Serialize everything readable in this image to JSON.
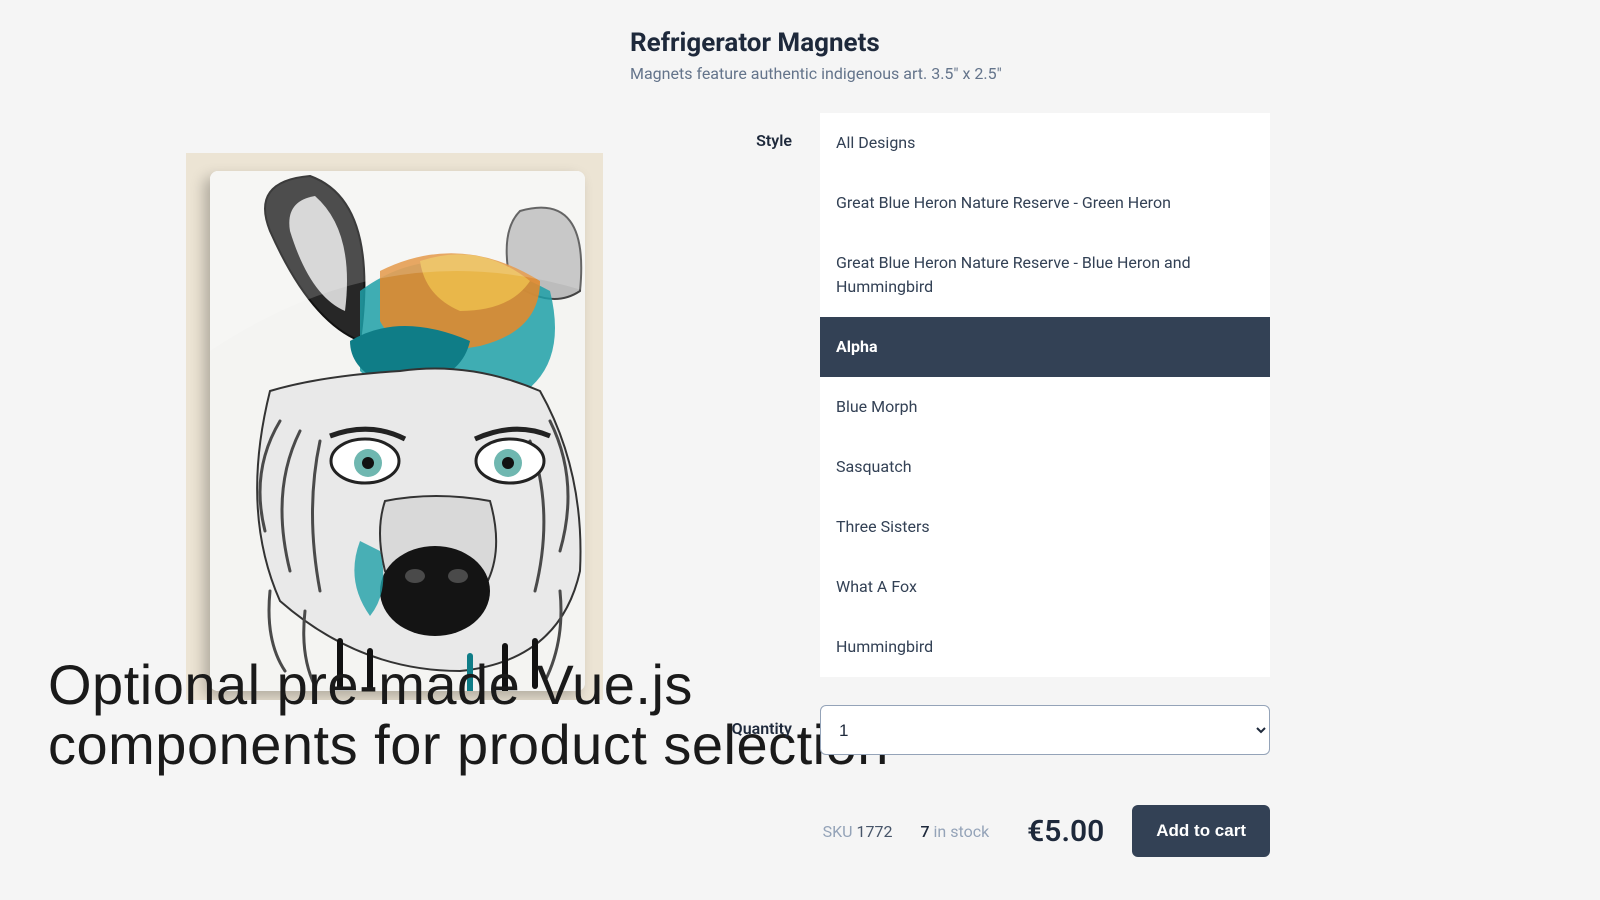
{
  "product": {
    "title": "Refrigerator Magnets",
    "subtitle": "Magnets feature authentic indigenous art. 3.5\" x 2.5\""
  },
  "style": {
    "label": "Style",
    "selected_index": 3,
    "options": [
      "All Designs",
      "Great Blue Heron Nature Reserve - Green Heron",
      "Great Blue Heron Nature Reserve - Blue Heron and Hummingbird",
      "Alpha",
      "Blue Morph",
      "Sasquatch",
      "Three Sisters",
      "What A Fox",
      "Hummingbird"
    ]
  },
  "quantity": {
    "label": "Quantity",
    "value": "1"
  },
  "meta": {
    "sku_label": "SKU",
    "sku_value": "1772",
    "stock_count": "7",
    "stock_suffix": "in stock",
    "price": "€5.00",
    "add_label": "Add to cart"
  },
  "caption": {
    "line1": "Optional pre-made Vue.js",
    "line2": "components for product selection"
  }
}
